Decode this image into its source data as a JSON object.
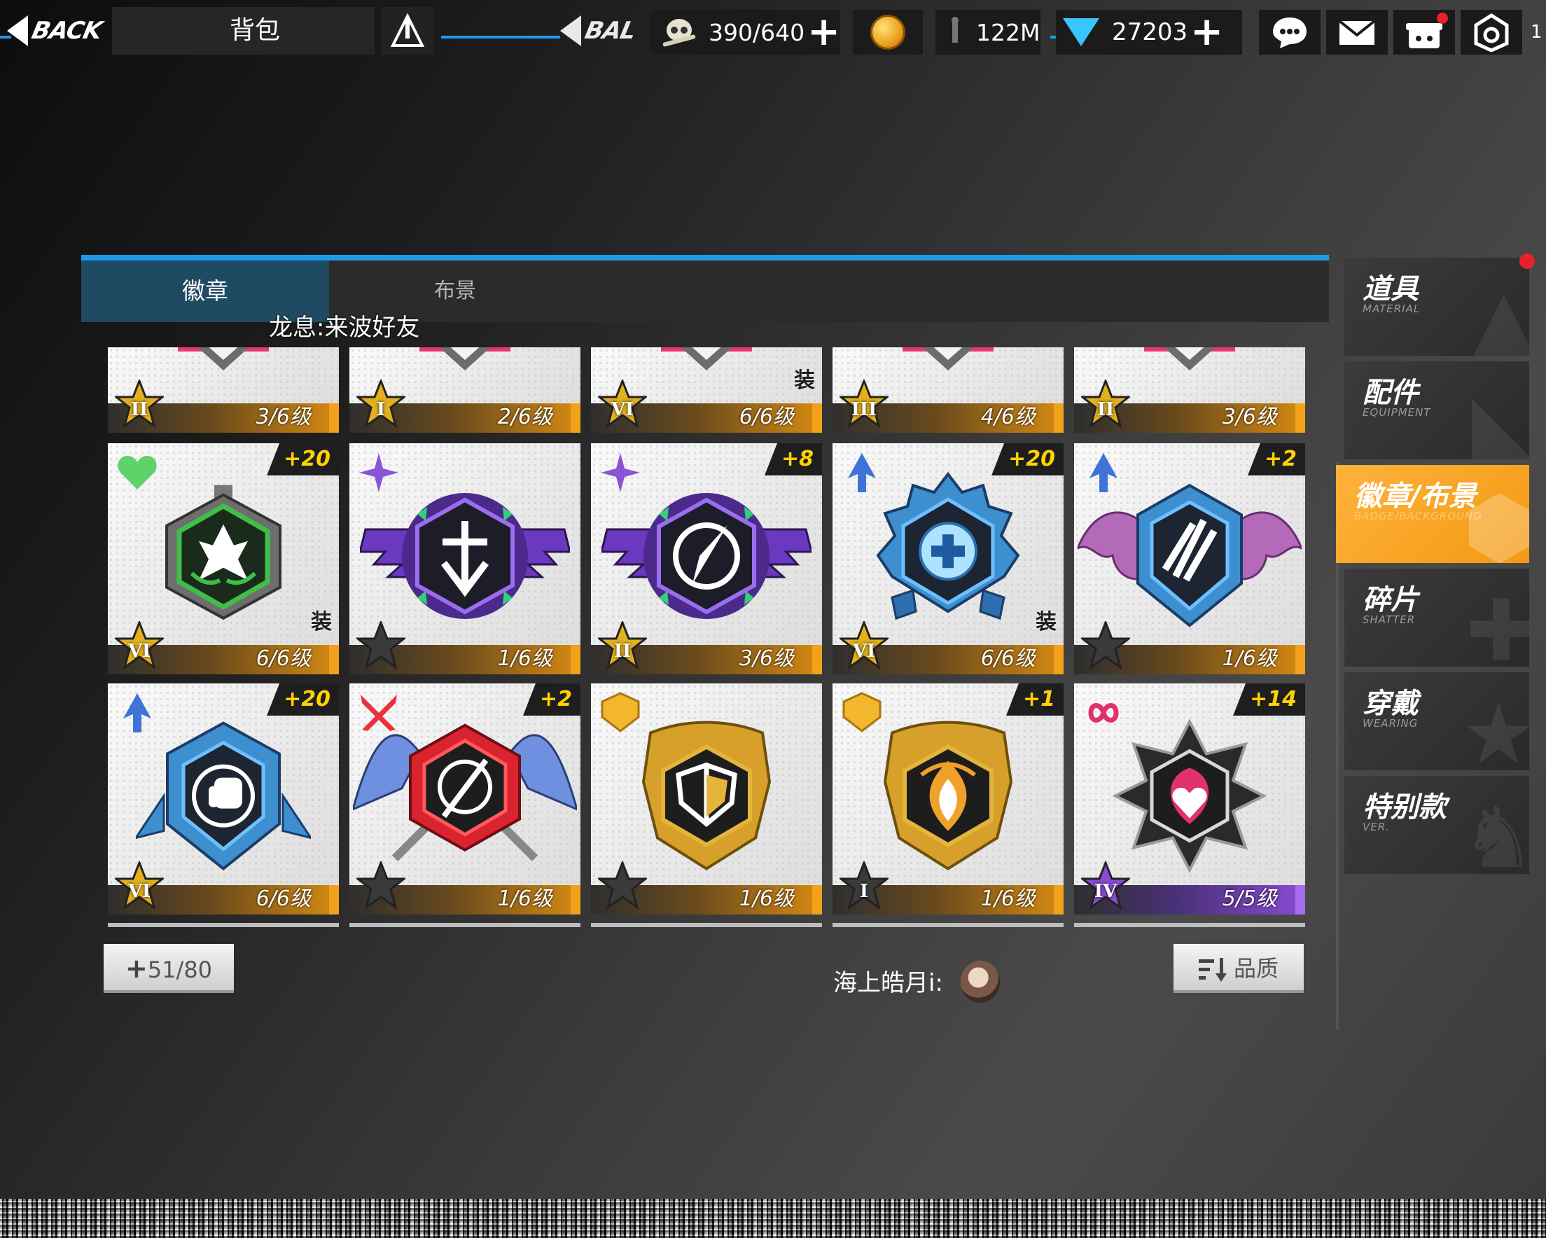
{
  "header": {
    "back_label": "BACK",
    "ghost_back_label": "BAL",
    "bag_title": "背包",
    "resources": {
      "stamina": "390/640",
      "distance": "122M",
      "diamonds": "27203",
      "edge_digit": "1"
    },
    "icons": [
      "back-arrow-icon",
      "triangle-person-icon",
      "skull-bone-icon",
      "gold-coin-icon",
      "diamond-icon",
      "chat-icon",
      "mail-icon",
      "gift-icon",
      "settings-icon"
    ]
  },
  "tabs": [
    {
      "label": "徽章",
      "active": true
    },
    {
      "label": "布景",
      "active": false
    }
  ],
  "chat_message": "龙息:来波好友",
  "badges": {
    "top_row": [
      {
        "rank": "II",
        "level": "3/6级",
        "equipped": false
      },
      {
        "rank": "I",
        "level": "2/6级",
        "equipped": false
      },
      {
        "rank": "VI",
        "level": "6/6级",
        "equipped": true
      },
      {
        "rank": "III",
        "level": "4/6级",
        "equipped": false
      },
      {
        "rank": "II",
        "level": "3/6级",
        "equipped": false
      }
    ],
    "row2": [
      {
        "rank": "VI",
        "level": "6/6级",
        "plus": "+20",
        "equipped": true,
        "type": "heart"
      },
      {
        "rank": "",
        "level": "1/6级",
        "plus": "",
        "equipped": false,
        "type": "sparkle"
      },
      {
        "rank": "II",
        "level": "3/6级",
        "plus": "+8",
        "equipped": false,
        "type": "sparkle"
      },
      {
        "rank": "VI",
        "level": "6/6级",
        "plus": "+20",
        "equipped": true,
        "type": "arrow"
      },
      {
        "rank": "",
        "level": "1/6级",
        "plus": "+2",
        "equipped": false,
        "type": "arrow"
      }
    ],
    "row3": [
      {
        "rank": "VI",
        "level": "6/6级",
        "plus": "+20",
        "equipped": false,
        "type": "arrow"
      },
      {
        "rank": "",
        "level": "1/6级",
        "plus": "+2",
        "equipped": false,
        "type": "sword"
      },
      {
        "rank": "",
        "level": "1/6级",
        "plus": "",
        "equipped": false,
        "type": "shield"
      },
      {
        "rank": "I",
        "level": "1/6级",
        "plus": "+1",
        "equipped": false,
        "type": "shield"
      },
      {
        "rank": "IV",
        "level": "5/5级",
        "plus": "+14",
        "equipped": false,
        "type": "infinity"
      }
    ],
    "equipped_label": "装"
  },
  "footer": {
    "capacity": "51/80",
    "chat_user": "海上皓月i:",
    "sort_label": "品质"
  },
  "sidebar": [
    {
      "cn": "道具",
      "en": "MATERIAL",
      "active": false
    },
    {
      "cn": "配件",
      "en": "EQUIPMENT",
      "active": false
    },
    {
      "cn": "徽章/布景",
      "en": "BADGE/BACKGROUND",
      "active": true
    },
    {
      "cn": "碎片",
      "en": "SHATTER",
      "active": false
    },
    {
      "cn": "穿戴",
      "en": "WEARING",
      "active": false
    },
    {
      "cn": "特别款",
      "en": "VER.",
      "active": false
    }
  ],
  "colors": {
    "accent_blue": "#1e9be8",
    "tab_active": "#204a62",
    "sidebar_active": "#f29a12",
    "level_orange": "#d78b12",
    "level_purple": "#8a4bd6"
  }
}
